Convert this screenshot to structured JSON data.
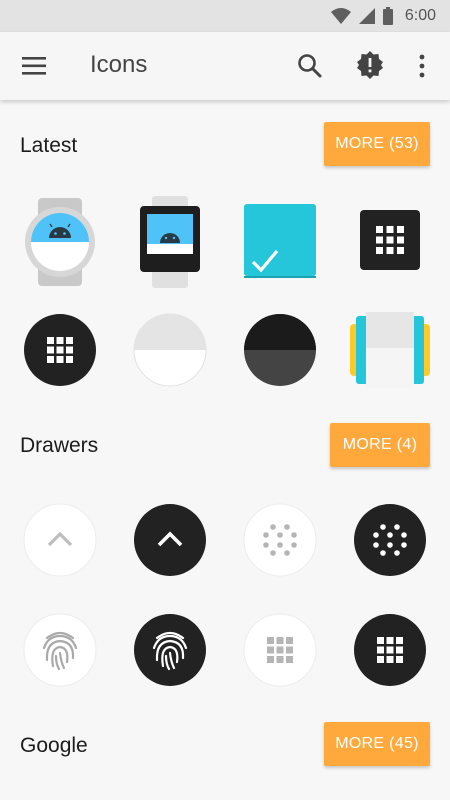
{
  "status_bar": {
    "time": "6:00"
  },
  "app_bar": {
    "title": "Icons"
  },
  "sections": [
    {
      "title": "Latest",
      "more_label": "MORE (53)"
    },
    {
      "title": "Drawers",
      "more_label": "MORE (4)"
    },
    {
      "title": "Google",
      "more_label": "MORE (45)"
    }
  ],
  "colors": {
    "accent": "#ffa93c",
    "android_blue": "#4fc3f7",
    "teal": "#26c6da",
    "dark_icon": "#222222"
  }
}
